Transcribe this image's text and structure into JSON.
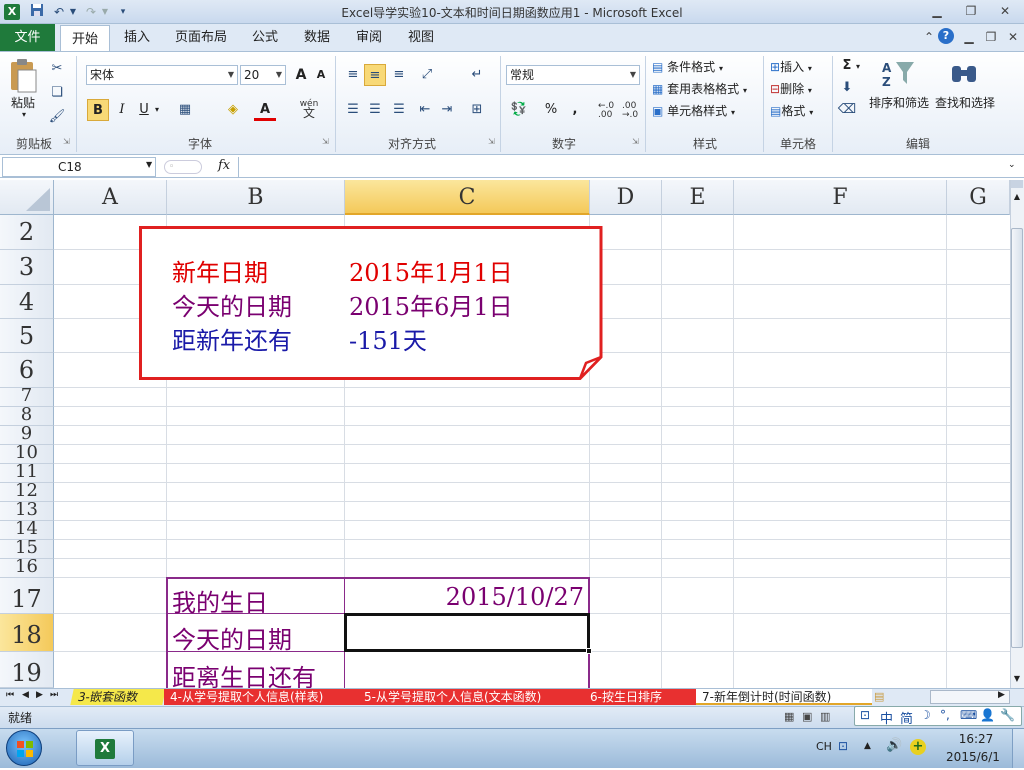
{
  "window": {
    "title": "Excel导学实验10-文本和时间日期函数应用1 - Microsoft Excel"
  },
  "qat": {
    "app_icon": "X"
  },
  "tabs": [
    {
      "label": "文件"
    },
    {
      "label": "开始"
    },
    {
      "label": "插入"
    },
    {
      "label": "页面布局"
    },
    {
      "label": "公式"
    },
    {
      "label": "数据"
    },
    {
      "label": "审阅"
    },
    {
      "label": "视图"
    }
  ],
  "ribbon": {
    "clipboard": {
      "label": "剪贴板",
      "paste": "粘贴"
    },
    "font": {
      "label": "字体",
      "name": "宋体",
      "size": "20",
      "bold": "B",
      "italic": "I",
      "underline": "U",
      "font_color_glyph": "A",
      "grow": "A",
      "shrink": "A",
      "wen": "wén",
      "wen_char": "文"
    },
    "alignment": {
      "label": "对齐方式"
    },
    "number": {
      "label": "数字",
      "format": "常规",
      "percent": "%",
      "comma": ",",
      "inc": "←.0\n.00",
      "dec": ".00\n→.0"
    },
    "styles": {
      "label": "样式",
      "cond": "条件格式",
      "table": "套用表格格式",
      "cell": "单元格样式"
    },
    "cells": {
      "label": "单元格",
      "insert": "插入",
      "delete": "删除",
      "format": "格式"
    },
    "editing": {
      "label": "编辑",
      "sum": "Σ",
      "sort": "排序和筛选",
      "find": "查找和选择"
    }
  },
  "formula_bar": {
    "name_box": "C18",
    "fx": "fx",
    "value": ""
  },
  "grid": {
    "columns": [
      "A",
      "B",
      "C",
      "D",
      "E",
      "F",
      "G"
    ],
    "rows": [
      "2",
      "3",
      "4",
      "5",
      "6",
      "7",
      "8",
      "9",
      "10",
      "11",
      "12",
      "13",
      "14",
      "15",
      "16",
      "17",
      "18",
      "19"
    ],
    "cells": {
      "b3": "新年日期",
      "c3": "2015年1月1日",
      "b4": "今天的日期",
      "c4": "2015年6月1日",
      "b5": "距新年还有",
      "c5": "-151天",
      "b17": "我的生日",
      "c17": "2015/10/27",
      "b18": "今天的日期",
      "c18": "",
      "b19": "距离生日还有",
      "c19": ""
    },
    "colors": {
      "red": "#e00000",
      "purple": "#7a0070",
      "blue": "#1a1aa8",
      "frame_red": "#e02020",
      "frame_purple": "#8a2a8a"
    }
  },
  "sheets": [
    {
      "label": "3-嵌套函数"
    },
    {
      "label": "4-从学号提取个人信息(样表)"
    },
    {
      "label": "5-从学号提取个人信息(文本函数)"
    },
    {
      "label": "6-按生日排序"
    },
    {
      "label": "7-新年倒计时(时间函数)"
    }
  ],
  "status": {
    "ready": "就绪",
    "ime": [
      "中",
      "简"
    ]
  },
  "taskbar": {
    "lang": "CH",
    "time": "16:27",
    "date": "2015/6/1"
  }
}
